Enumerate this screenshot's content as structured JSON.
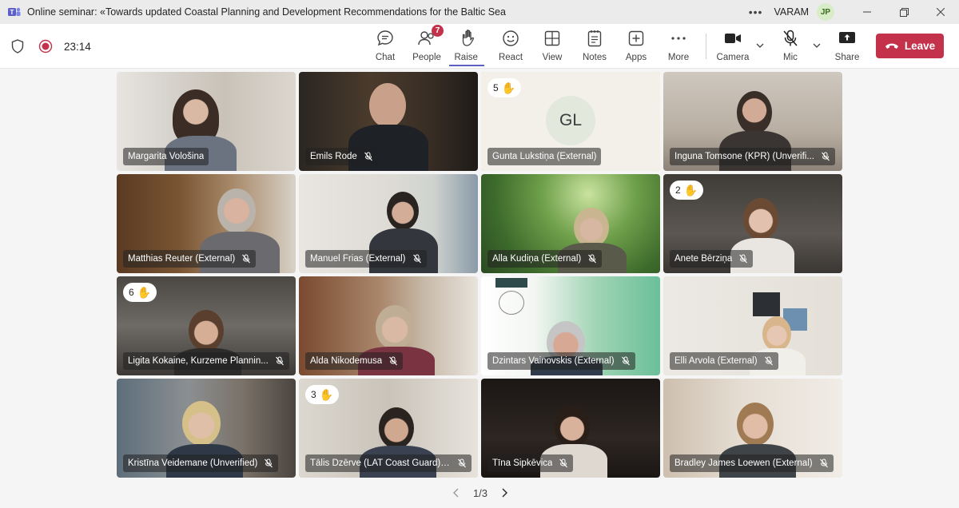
{
  "window": {
    "title": "Online seminar: «Towards updated Coastal Planning and Development Recommendations for the Baltic Sea Regio...",
    "more_label": "•••",
    "org": "VARAM",
    "avatar_initials": "JP"
  },
  "toolbar": {
    "timer": "23:14",
    "chat": "Chat",
    "people": "People",
    "people_badge": "7",
    "raise": "Raise",
    "react": "React",
    "view": "View",
    "notes": "Notes",
    "apps": "Apps",
    "more": "More",
    "camera": "Camera",
    "mic": "Mic",
    "share": "Share",
    "leave": "Leave"
  },
  "participants": [
    {
      "name": "Margarita Vološina",
      "muted": false,
      "raised": false
    },
    {
      "name": "Emils Rode",
      "muted": true,
      "raised": false
    },
    {
      "name": "Gunta Lukstiņa (External)",
      "muted": false,
      "raised": true,
      "raise_order": "5",
      "initials": "GL"
    },
    {
      "name": "Inguna Tomsone (KPR) (Unverifi...",
      "muted": true,
      "raised": false
    },
    {
      "name": "Matthias Reuter (External)",
      "muted": true,
      "raised": false
    },
    {
      "name": "Manuel Frias (External)",
      "muted": true,
      "raised": false
    },
    {
      "name": "Alla Kudiņa (External)",
      "muted": true,
      "raised": false
    },
    {
      "name": "Anete Bērziņa",
      "muted": true,
      "raised": true,
      "raise_order": "2"
    },
    {
      "name": "Ligita Kokaine, Kurzeme Plannin...",
      "muted": true,
      "raised": true,
      "raise_order": "6"
    },
    {
      "name": "Alda Nikodemusa",
      "muted": true,
      "raised": false
    },
    {
      "name": "Dzintars Vainovskis (External)",
      "muted": true,
      "raised": false
    },
    {
      "name": "Elli Arvola (External)",
      "muted": true,
      "raised": false
    },
    {
      "name": "Kristīna Veidemane (Unverified)",
      "muted": true,
      "raised": false
    },
    {
      "name": "Tālis Dzērve (LAT Coast Guard) (...",
      "muted": true,
      "raised": true,
      "raise_order": "3"
    },
    {
      "name": "Tīna Šipkēvica",
      "muted": true,
      "raised": false
    },
    {
      "name": "Bradley James Loewen (External)",
      "muted": true,
      "raised": false
    }
  ],
  "pager": {
    "label": "1/3"
  },
  "colors": {
    "raise_accent": "#f2b01e",
    "leave": "#c4314b",
    "active_tab": "#5b5fc7"
  }
}
